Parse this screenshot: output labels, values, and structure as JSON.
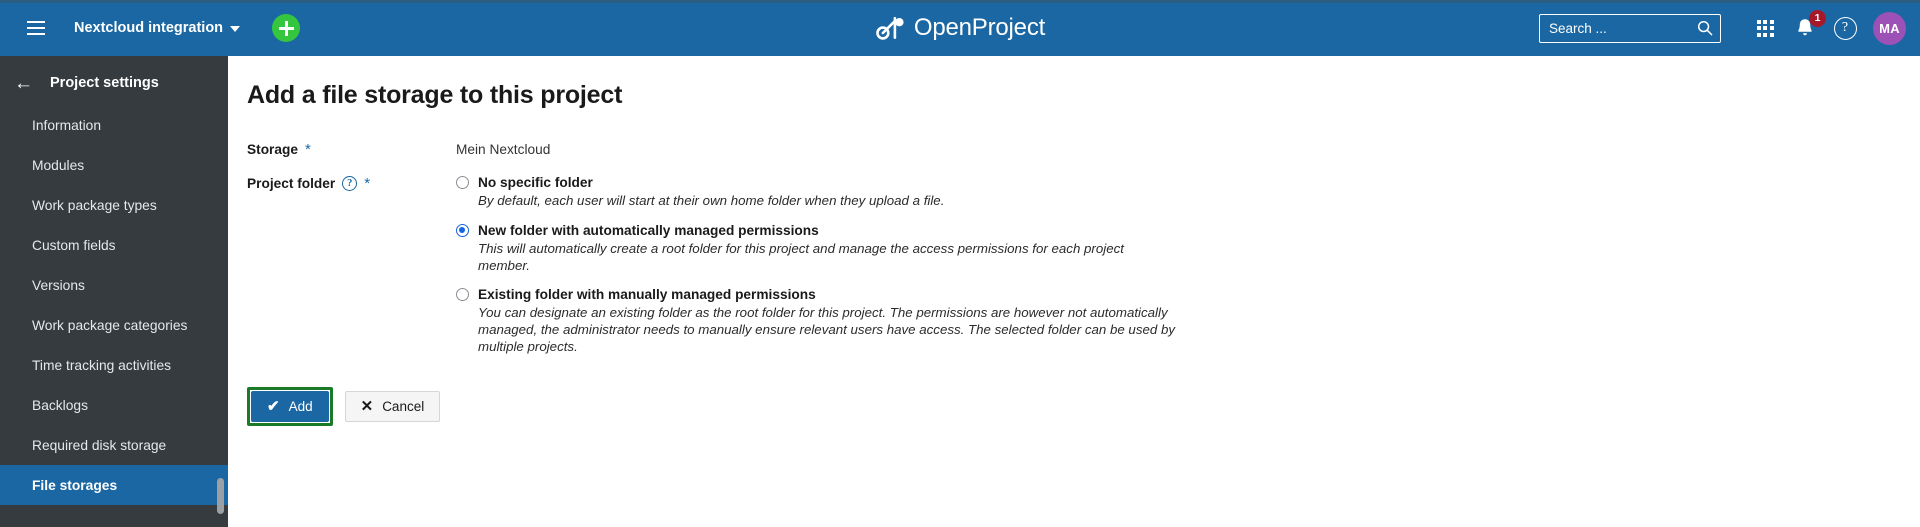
{
  "header": {
    "menu_icon": "hamburger-icon",
    "project_name": "Nextcloud integration",
    "add_icon": "plus-icon",
    "brand": "OpenProject",
    "brand_logo_icon": "openproject-logo-icon",
    "search": {
      "placeholder": "Search ...",
      "value": "",
      "icon": "search-icon"
    },
    "modules_icon": "grid-apps-icon",
    "notifications_icon": "bell-icon",
    "notifications_count": "1",
    "help_icon": "question-mark-icon",
    "help_label": "?",
    "avatar_initials": "MA",
    "colors": {
      "header_bg": "#1a67a3",
      "add_button": "#35c53f",
      "badge": "#a5192b",
      "avatar": "#9b51b5"
    }
  },
  "sidebar": {
    "back_icon": "arrow-left-icon",
    "title": "Project settings",
    "items": [
      {
        "label": "Information",
        "active": false
      },
      {
        "label": "Modules",
        "active": false
      },
      {
        "label": "Work package types",
        "active": false
      },
      {
        "label": "Custom fields",
        "active": false
      },
      {
        "label": "Versions",
        "active": false
      },
      {
        "label": "Work package categories",
        "active": false
      },
      {
        "label": "Time tracking activities",
        "active": false
      },
      {
        "label": "Backlogs",
        "active": false
      },
      {
        "label": "Required disk storage",
        "active": false
      },
      {
        "label": "File storages",
        "active": true
      }
    ],
    "colors": {
      "bg": "#353b3f",
      "active_bg": "#1a67a3"
    }
  },
  "main": {
    "title": "Add a file storage to this project",
    "form": {
      "storage": {
        "label": "Storage",
        "required_marker": "*",
        "value": "Mein Nextcloud"
      },
      "project_folder": {
        "label": "Project folder",
        "help_icon": "question-mark-circle-icon",
        "help_label": "?",
        "required_marker": "*",
        "options": [
          {
            "label": "No specific folder",
            "description": "By default, each user will start at their own home folder when they upload a file.",
            "selected": false
          },
          {
            "label": "New folder with automatically managed permissions",
            "description": "This will automatically create a root folder for this project and manage the access permissions for each project member.",
            "selected": true
          },
          {
            "label": "Existing folder with manually managed permissions",
            "description": "You can designate an existing folder as the root folder for this project. The permissions are however not automatically managed, the administrator needs to manually ensure relevant users have access. The selected folder can be used by multiple projects.",
            "selected": false
          }
        ]
      }
    },
    "buttons": {
      "submit_label": "Add",
      "submit_icon": "check-icon",
      "submit_glyph": "✔",
      "submit_focused": true,
      "cancel_label": "Cancel",
      "cancel_icon": "close-x-icon",
      "cancel_glyph": "✕"
    },
    "colors": {
      "primary_button": "#1a67a3",
      "focus_ring": "#1b7a28",
      "radio_selected": "#1764e0",
      "required_star": "#1a67a3"
    }
  }
}
